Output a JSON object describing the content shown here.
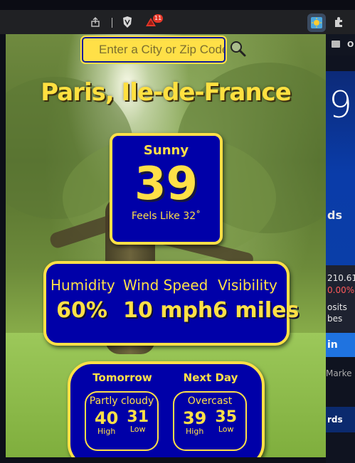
{
  "browser": {
    "share_icon": "share-icon",
    "brave_icon": "brave-shield-icon",
    "alert_badge": "11",
    "extension_icon": "weather-extension-icon",
    "puzzle_icon": "extensions-puzzle-icon"
  },
  "background_page": {
    "bookmark_label": "O",
    "big_number": "9",
    "cards_fragment": "ds",
    "price": "210.61",
    "change": "0.00%",
    "deposits_1": "osits",
    "deposits_2": "bes",
    "button_fragment": "in",
    "market_fragment": "Marke",
    "cards_fragment_2": "rds"
  },
  "popup": {
    "search": {
      "placeholder": "Enter a City or Zip Code"
    },
    "city": "Paris, Ile-de-France",
    "current": {
      "condition": "Sunny",
      "temperature": "39",
      "feels_like": "Feels Like 32˚"
    },
    "stats": [
      {
        "label": "Humidity",
        "value": "60%"
      },
      {
        "label": "Wind Speed",
        "value": "10 mph"
      },
      {
        "label": "Visibility",
        "value": "6 miles"
      }
    ],
    "forecast": {
      "tomorrow": {
        "heading": "Tomorrow",
        "condition": "Partly cloudy",
        "high": "40",
        "low": "31",
        "high_label": "High",
        "low_label": "Low"
      },
      "next_day": {
        "heading": "Next Day",
        "condition": "Overcast",
        "high": "39",
        "low": "35",
        "high_label": "High",
        "low_label": "Low"
      }
    }
  },
  "colors": {
    "accent_yellow": "#ffe047",
    "card_blue": "#0000a8"
  }
}
